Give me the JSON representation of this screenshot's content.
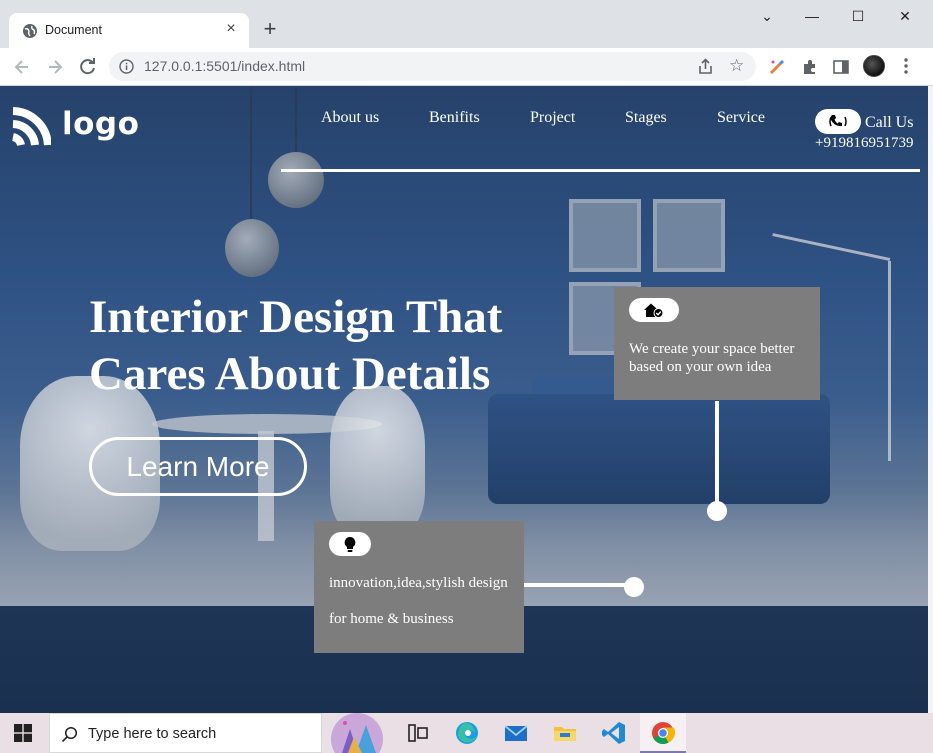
{
  "browser": {
    "tab_title": "Document",
    "tab_close": "×",
    "new_tab": "+",
    "url": "127.0.0.1:5501/index.html",
    "window_controls": {
      "minimize": "—",
      "maximize": "☐",
      "close": "✕",
      "tabsearch": "⌄"
    }
  },
  "site": {
    "logo_text": "logo",
    "nav": [
      "About us",
      "Benifits",
      "Project",
      "Stages",
      "Service"
    ],
    "call_label": "Call Us",
    "call_number": "+919816951739",
    "headline_line1": "Interior Design That",
    "headline_line2": "Cares About Details",
    "cta_label": "Learn More",
    "card_top_text": "We create your space better based on your own idea",
    "card_bottom_line1": "innovation,idea,stylish design",
    "card_bottom_line2": "for home & business"
  },
  "taskbar": {
    "search_placeholder": "Type here to search",
    "apps": [
      "widgets",
      "task-view",
      "edge",
      "mail",
      "file-explorer",
      "vscode",
      "chrome"
    ]
  },
  "colors": {
    "card_bg": "#7d7d7d",
    "hero_blue": "#2e5183",
    "chrome_tabbar": "#dee1e6"
  }
}
